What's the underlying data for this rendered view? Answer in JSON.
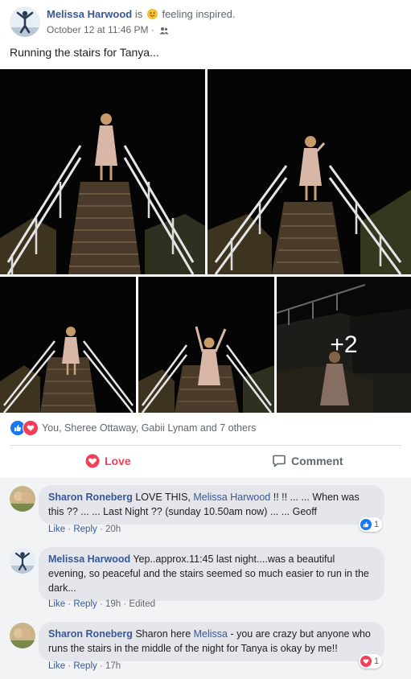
{
  "post": {
    "author": "Melissa Harwood",
    "feeling_prefix": "is",
    "feeling": "feeling inspired.",
    "timestamp": "October 12 at 11:46 PM",
    "audience_icon": "friends-icon",
    "text": "Running the stairs for Tanya..."
  },
  "photos": {
    "more_count": "+2"
  },
  "reactions": {
    "icons": [
      "like-icon",
      "love-icon"
    ],
    "summary": "You, Sheree Ottaway, Gabii Lynam and 7 others"
  },
  "actions": {
    "love_label": "Love",
    "comment_label": "Comment"
  },
  "comments": [
    {
      "author": "Sharon Roneberg",
      "text_before": " LOVE THIS, ",
      "mention": "Melissa Harwood",
      "text_after": " !! !! ... ... When was this ?? ... ... Last Night ?? (sunday 10.50am now) ... ... Geoff",
      "like_label": "Like",
      "reply_label": "Reply",
      "time": "20h",
      "reaction_count": "1",
      "reaction_type": "like"
    },
    {
      "author": "Melissa Harwood",
      "text": " Yep..approx.11:45 last night....was a beautiful evening, so peaceful and the stairs seemed so much easier to run in the dark...",
      "like_label": "Like",
      "reply_label": "Reply",
      "time": "19h",
      "edited_label": "Edited"
    },
    {
      "author": "Sharon Roneberg",
      "text_before": " Sharon here ",
      "mention": "Melissa",
      "text_after": " - you are crazy but anyone who runs the stairs in the middle of the night for Tanya is okay by me!!",
      "like_label": "Like",
      "reply_label": "Reply",
      "time": "17h",
      "reaction_count": "1",
      "reaction_type": "love"
    }
  ],
  "colors": {
    "link": "#365899",
    "like_blue": "#1877f2",
    "love_red": "#f33e58",
    "muted": "#606770",
    "bubble": "#e4e6eb"
  }
}
